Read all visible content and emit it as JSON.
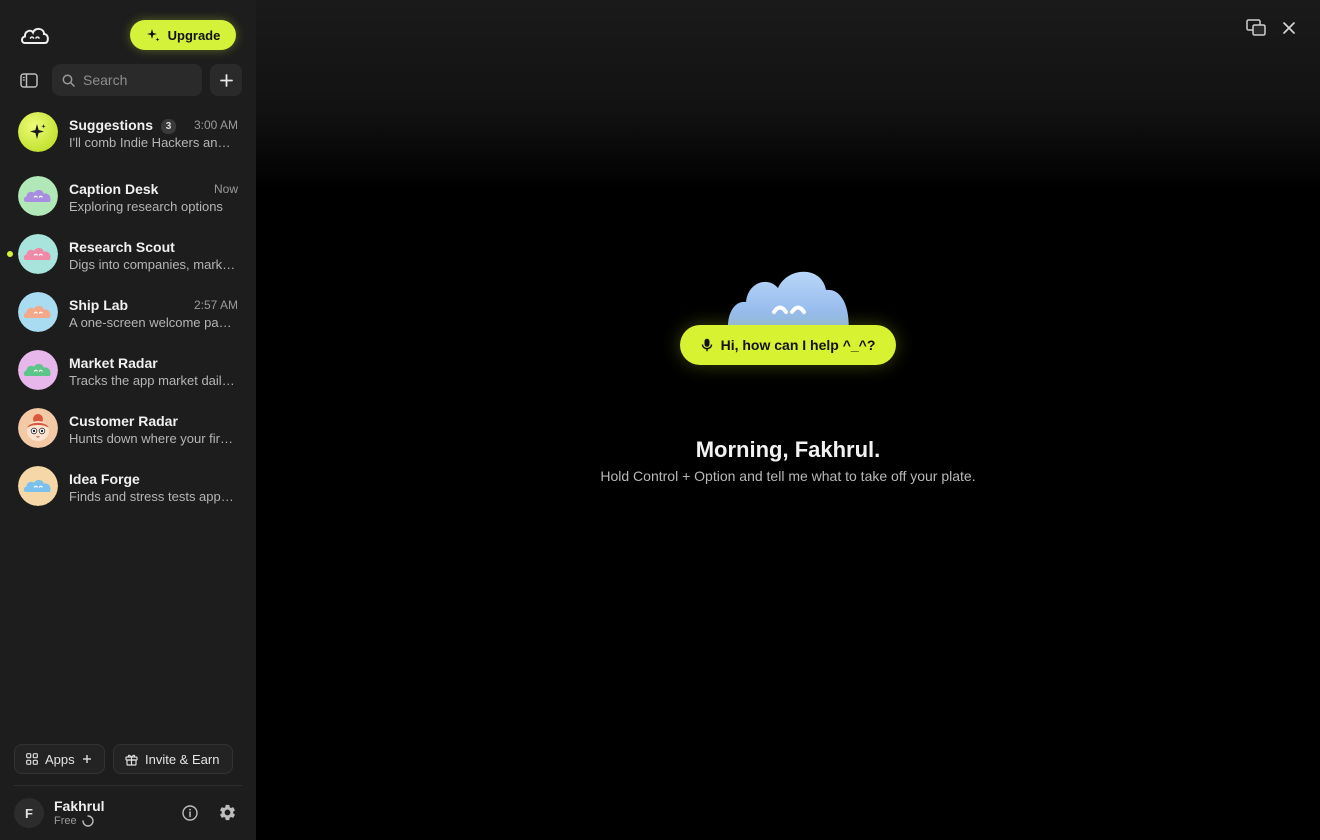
{
  "sidebar": {
    "upgrade_label": "Upgrade",
    "search_placeholder": "Search",
    "chats": [
      {
        "name": "Suggestions",
        "badge": "3",
        "time": "3:00 AM",
        "preview": "I'll comb Indie Hackers and Reddit for you",
        "unread": false,
        "avatar": "sparkle-icon"
      },
      {
        "name": "Caption Desk",
        "badge": "",
        "time": "Now",
        "preview": "Exploring research options",
        "unread": false,
        "avatar": "purple-cloud"
      },
      {
        "name": "Research Scout",
        "badge": "",
        "time": "",
        "preview": "Digs into companies, markets and people",
        "unread": true,
        "avatar": "pink-cloud"
      },
      {
        "name": "Ship Lab",
        "badge": "",
        "time": "2:57 AM",
        "preview": "A one-screen welcome page for your app",
        "unread": false,
        "avatar": "peach-cloud"
      },
      {
        "name": "Market Radar",
        "badge": "",
        "time": "",
        "preview": "Tracks the app market daily for you",
        "unread": false,
        "avatar": "green-cloud"
      },
      {
        "name": "Customer Radar",
        "badge": "",
        "time": "",
        "preview": "Hunts down where your first users hang out",
        "unread": false,
        "avatar": "girl-face"
      },
      {
        "name": "Idea Forge",
        "badge": "",
        "time": "",
        "preview": "Finds and stress tests app ideas",
        "unread": false,
        "avatar": "blue-cloud"
      }
    ],
    "apps_label": "Apps",
    "invite_label": "Invite & Earn",
    "user": {
      "initial": "F",
      "name": "Fakhrul",
      "plan": "Free"
    }
  },
  "main": {
    "help_label": "Hi, how can I help ^_^?",
    "greeting": "Morning, Fakhrul.",
    "hint": "Hold Control + Option and tell me what to take off your plate."
  },
  "colors": {
    "accent": "#d4f23a",
    "sidebar_bg": "#1d1d1d",
    "main_bg": "#000000",
    "unread_dot": "#d4f23a"
  }
}
